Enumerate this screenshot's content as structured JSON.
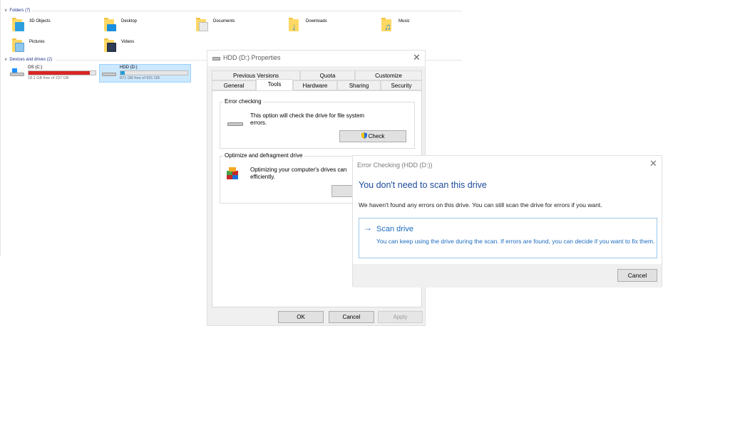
{
  "explorer": {
    "folders_header": "Folders (7)",
    "folders": [
      {
        "name": "3D Objects",
        "icon": "3d-objects-folder-icon",
        "color": "#2f9fe0"
      },
      {
        "name": "Desktop",
        "icon": "desktop-folder-icon",
        "color": "#1a8fde"
      },
      {
        "name": "Documents",
        "icon": "documents-folder-icon",
        "color": "#e8e8e8"
      },
      {
        "name": "Downloads",
        "icon": "downloads-folder-icon",
        "color": "#1e88d8"
      },
      {
        "name": "Music",
        "icon": "music-folder-icon",
        "color": "#2a8ad6"
      },
      {
        "name": "Pictures",
        "icon": "pictures-folder-icon",
        "color": "#8ec7ee"
      },
      {
        "name": "Videos",
        "icon": "videos-folder-icon",
        "color": "#2d3b55"
      }
    ],
    "devices_header": "Devices and drives (2)",
    "drives": [
      {
        "name": "OS (C:)",
        "free": "18.1 GB free of 237 GB",
        "used_fraction": 0.92,
        "bar_color": "#da2626",
        "selected": false
      },
      {
        "name": "HDD (D:)",
        "free": "871 GB free of 931 GB",
        "used_fraction": 0.06,
        "bar_color": "#26a0da",
        "selected": true
      }
    ]
  },
  "properties": {
    "title": "HDD (D:) Properties",
    "tabs_row1": [
      "Previous Versions",
      "Quota",
      "Customize"
    ],
    "tabs_row2": [
      "General",
      "Tools",
      "Hardware",
      "Sharing",
      "Security"
    ],
    "active_tab": "Tools",
    "error_checking": {
      "title": "Error checking",
      "text_line1": "This option will check the drive for file system",
      "text_line2": "errors.",
      "check_label": "Check"
    },
    "optimize": {
      "title": "Optimize and defragment drive",
      "text_line1": "Optimizing your computer's drives can",
      "text_line2": "efficiently."
    },
    "ok_label": "OK",
    "cancel_label": "Cancel",
    "apply_label": "Apply"
  },
  "error_dialog": {
    "title": "Error Checking (HDD (D:))",
    "heading": "You don't need to scan this drive",
    "body": "We haven't found any errors on this drive. You can still scan the drive for errors if you want.",
    "scan_title": "Scan drive",
    "scan_desc": "You can keep using the drive during the scan. If errors are found, you can decide if you want to fix them.",
    "cancel_label": "Cancel",
    "accent_color": "#1c6bbf"
  }
}
